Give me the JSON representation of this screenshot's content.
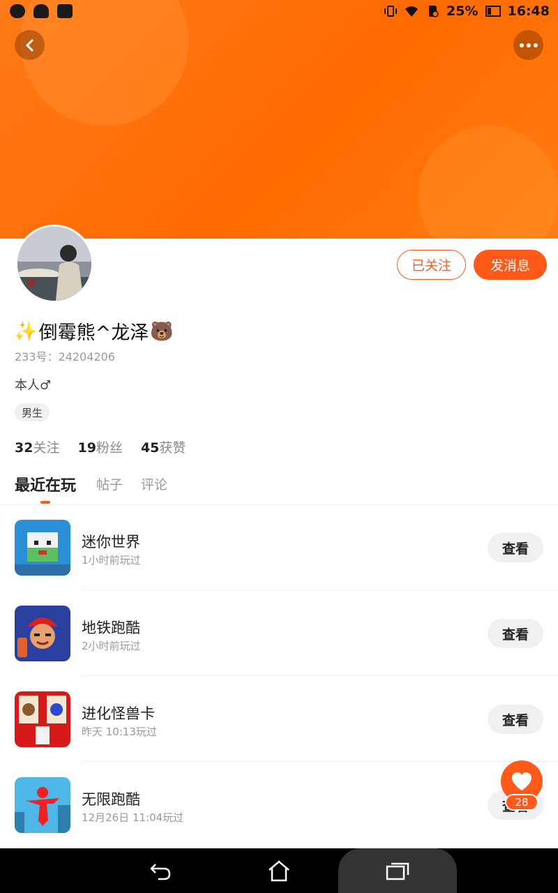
{
  "status_bar": {
    "battery": "25%",
    "time": "16:48"
  },
  "profile": {
    "username_prefix_emoji": "✨",
    "username": "倒霉熊^龙泽",
    "username_suffix_emoji": "🐻",
    "id_line": "233号：24204206",
    "bio": "本人♂",
    "gender_tag": "男生",
    "follow_button": "已关注",
    "message_button": "发消息"
  },
  "stats": [
    {
      "count": "32",
      "label": "关注"
    },
    {
      "count": "19",
      "label": "粉丝"
    },
    {
      "count": "45",
      "label": "获赞"
    }
  ],
  "tabs": [
    {
      "label": "最近在玩",
      "active": true
    },
    {
      "label": "帖子",
      "active": false
    },
    {
      "label": "评论",
      "active": false
    }
  ],
  "games": [
    {
      "name": "迷你世界",
      "last_played": "1小时前玩过",
      "action": "查看"
    },
    {
      "name": "地铁跑酷",
      "last_played": "2小时前玩过",
      "action": "查看"
    },
    {
      "name": "进化怪兽卡",
      "last_played": "昨天 10:13玩过",
      "action": "查看"
    },
    {
      "name": "无限跑酷",
      "last_played": "12月26日 11:04玩过",
      "action": "查看"
    }
  ],
  "favorite": {
    "count": "28"
  },
  "colors": {
    "accent": "#ff5a1a",
    "banner": "#ff7010"
  }
}
